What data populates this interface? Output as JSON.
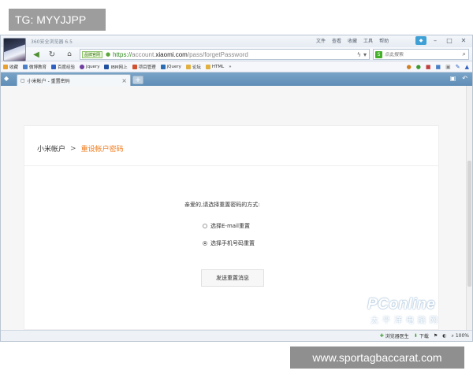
{
  "overlays": {
    "tag": "TG: MYYJJPP",
    "site": "www.sportagbaccarat.com"
  },
  "browser": {
    "app_title": "360安全浏览器 6.5",
    "title_menu": [
      "文件",
      "查看",
      "收藏",
      "工具",
      "帮助"
    ],
    "window_controls": [
      "skin-icon",
      "minimize-icon",
      "maximize-icon",
      "close-icon"
    ],
    "nav": {
      "secure_badge": "品牌官网",
      "url_scheme": "https://",
      "url_host_pre": "account.",
      "url_host": "xiaomi.com",
      "url_path": "/pass/forgetPassword"
    },
    "search": {
      "placeholder": "点此搜索"
    },
    "bookmarks": [
      {
        "label": "收藏",
        "color": "#e8a030"
      },
      {
        "label": "微博教育",
        "color": "#4a80c8"
      },
      {
        "label": "百度经验",
        "color": "#3060c0"
      },
      {
        "label": "jquery",
        "color": "#7040a0"
      },
      {
        "label": "IBM网上",
        "color": "#2050a0"
      },
      {
        "label": "项目管理",
        "color": "#d05030"
      },
      {
        "label": "jQuery",
        "color": "#2a6db5"
      },
      {
        "label": "论坛",
        "color": "#e0b040"
      },
      {
        "label": "HTML",
        "color": "#e0b040"
      }
    ],
    "tab": {
      "label": "小米帐户 - 重置密码"
    }
  },
  "page": {
    "breadcrumb": {
      "root": "小米帐户",
      "separator": ">",
      "current": "重设帐户密码"
    },
    "prompt": "亲爱的,请选择重置密码的方式:",
    "options": [
      {
        "label": "选择E-mail重置",
        "checked": false
      },
      {
        "label": "选择手机号码重置",
        "checked": true
      }
    ],
    "send_button": "发送重置消息",
    "colors": {
      "accent": "#f07a1a",
      "tabbar": "#6f99bf"
    }
  },
  "statusbar": {
    "doctor": "浏览器医生",
    "download": "下载",
    "zoom": "100%"
  },
  "watermark": {
    "brand": "PConline",
    "sub": "太平洋电脑网"
  }
}
